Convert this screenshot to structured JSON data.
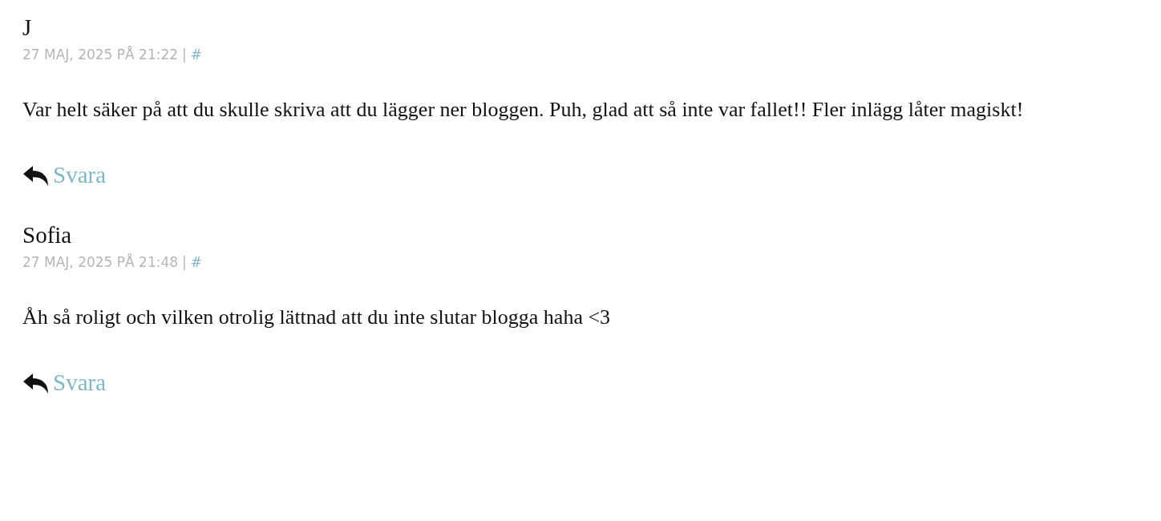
{
  "comments": [
    {
      "author": "J",
      "date": "27 MAJ, 2025 PÅ 21:22",
      "separator": "|",
      "permalink": "#",
      "text": "Var helt säker på att du skulle skriva att du lägger ner bloggen. Puh, glad att så inte var fallet!! Fler inlägg låter magiskt!",
      "reply": "Svara"
    },
    {
      "author": "Sofia",
      "date": "27 MAJ, 2025 PÅ 21:48",
      "separator": "|",
      "permalink": "#",
      "text": "Åh så roligt och vilken otrolig lättnad att du inte slutar blogga haha <3",
      "reply": "Svara"
    }
  ]
}
